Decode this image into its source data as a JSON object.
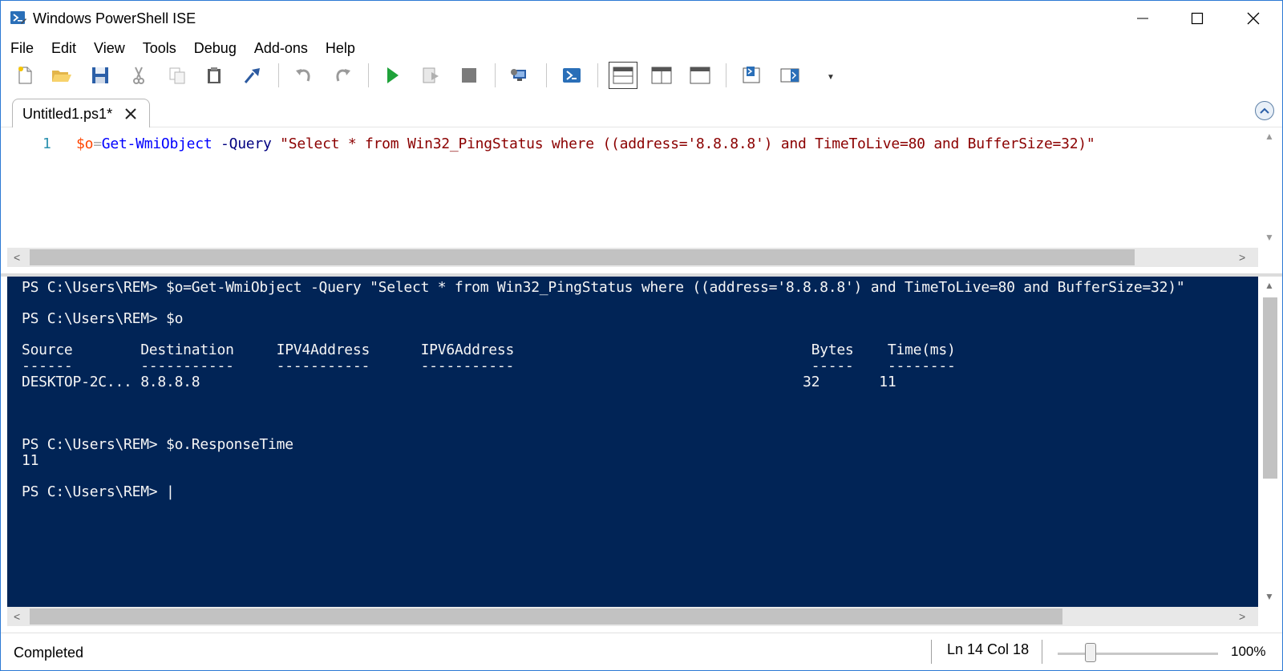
{
  "window": {
    "title": "Windows PowerShell ISE",
    "accent_color": "#2b79d4"
  },
  "menu": {
    "items": [
      "File",
      "Edit",
      "View",
      "Tools",
      "Debug",
      "Add-ons",
      "Help"
    ]
  },
  "toolbar": {
    "buttons": [
      "new-script-icon",
      "open-icon",
      "save-icon",
      "cut-icon",
      "copy-icon",
      "paste-icon",
      "clear-console-icon",
      "undo-icon",
      "redo-icon",
      "run-script-icon",
      "run-selection-icon",
      "stop-icon",
      "remote-powershell-icon",
      "start-powershell-icon",
      "show-script-top-icon",
      "show-script-right-icon",
      "show-script-maximized-icon",
      "show-command-window-icon",
      "show-command-addon-icon",
      "toolbar-overflow-icon"
    ]
  },
  "script_pane": {
    "tab_label": "Untitled1.ps1*",
    "line_number": "1",
    "code": {
      "var": "$o",
      "op": "=",
      "cmd": "Get-WmiObject",
      "param": "-Query",
      "string": "\"Select * from Win32_PingStatus where ((address='8.8.8.8') and TimeToLive=80 and BufferSize=32)\""
    }
  },
  "console": {
    "background": "#012456",
    "lines": [
      "PS C:\\Users\\REM> $o=Get-WmiObject -Query \"Select * from Win32_PingStatus where ((address='8.8.8.8') and TimeToLive=80 and BufferSize=32)\"",
      "",
      "PS C:\\Users\\REM> $o",
      "",
      "Source        Destination     IPV4Address      IPV6Address                                   Bytes    Time(ms)",
      "------        -----------     -----------      -----------                                   -----    --------",
      "DESKTOP-2C... 8.8.8.8                                                                       32       11",
      "",
      "",
      "",
      "PS C:\\Users\\REM> $o.ResponseTime",
      "11",
      "",
      "PS C:\\Users\\REM> |"
    ]
  },
  "status": {
    "state": "Completed",
    "position": "Ln 14  Col 18",
    "zoom": "100%"
  }
}
